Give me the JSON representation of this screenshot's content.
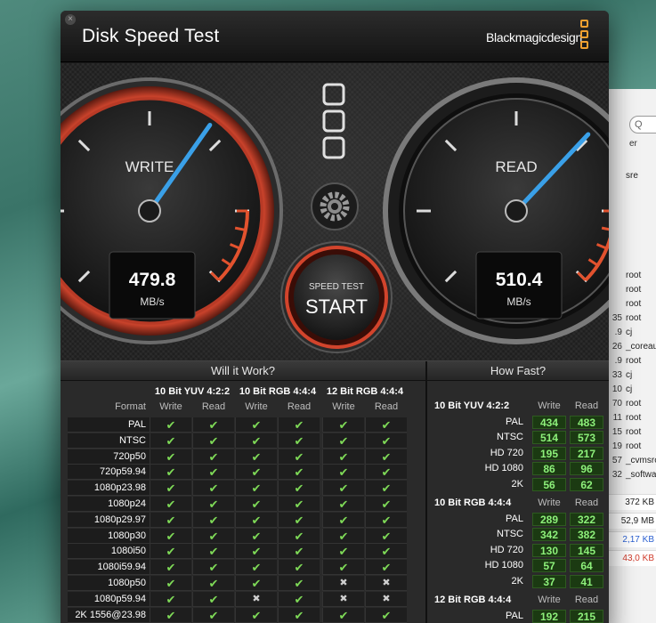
{
  "app": {
    "title": "Disk Speed Test",
    "brand": "Blackmagicdesign",
    "colors": {
      "accent": "#f0a030",
      "needle": "#3aa0e8",
      "ok": "#7ed957",
      "start_ring": "#d2442c"
    }
  },
  "gauges": {
    "write": {
      "label": "WRITE",
      "value": "479.8",
      "unit": "MB/s",
      "fraction": 0.63
    },
    "read": {
      "label": "READ",
      "value": "510.4",
      "unit": "MB/s",
      "fraction": 0.66
    }
  },
  "start_button": {
    "top": "SPEED TEST",
    "main": "START"
  },
  "icons": {
    "settings": "gear-icon",
    "close": "close-icon"
  },
  "will_it_work": {
    "title": "Will it Work?",
    "format_label": "Format",
    "groups": [
      "10 Bit YUV 4:2:2",
      "10 Bit RGB 4:4:4",
      "12 Bit RGB 4:4:4"
    ],
    "sub": [
      "Write",
      "Read",
      "Write",
      "Read",
      "Write",
      "Read"
    ],
    "rows": [
      {
        "format": "PAL",
        "cells": [
          1,
          1,
          1,
          1,
          1,
          1
        ]
      },
      {
        "format": "NTSC",
        "cells": [
          1,
          1,
          1,
          1,
          1,
          1
        ]
      },
      {
        "format": "720p50",
        "cells": [
          1,
          1,
          1,
          1,
          1,
          1
        ]
      },
      {
        "format": "720p59.94",
        "cells": [
          1,
          1,
          1,
          1,
          1,
          1
        ]
      },
      {
        "format": "1080p23.98",
        "cells": [
          1,
          1,
          1,
          1,
          1,
          1
        ]
      },
      {
        "format": "1080p24",
        "cells": [
          1,
          1,
          1,
          1,
          1,
          1
        ]
      },
      {
        "format": "1080p29.97",
        "cells": [
          1,
          1,
          1,
          1,
          1,
          1
        ]
      },
      {
        "format": "1080p30",
        "cells": [
          1,
          1,
          1,
          1,
          1,
          1
        ]
      },
      {
        "format": "1080i50",
        "cells": [
          1,
          1,
          1,
          1,
          1,
          1
        ]
      },
      {
        "format": "1080i59.94",
        "cells": [
          1,
          1,
          1,
          1,
          1,
          1
        ]
      },
      {
        "format": "1080p50",
        "cells": [
          1,
          1,
          1,
          1,
          0,
          0
        ]
      },
      {
        "format": "1080p59.94",
        "cells": [
          1,
          1,
          0,
          1,
          0,
          0
        ]
      },
      {
        "format": "2K 1556@23.98",
        "cells": [
          1,
          1,
          1,
          1,
          1,
          1
        ]
      }
    ]
  },
  "how_fast": {
    "title": "How Fast?",
    "write_label": "Write",
    "read_label": "Read",
    "groups": [
      {
        "name": "10 Bit YUV 4:2:2",
        "rows": [
          {
            "format": "PAL",
            "write": "434",
            "read": "483"
          },
          {
            "format": "NTSC",
            "write": "514",
            "read": "573"
          },
          {
            "format": "HD 720",
            "write": "195",
            "read": "217"
          },
          {
            "format": "HD 1080",
            "write": "86",
            "read": "96"
          },
          {
            "format": "2K",
            "write": "56",
            "read": "62"
          }
        ]
      },
      {
        "name": "10 Bit RGB 4:4:4",
        "rows": [
          {
            "format": "PAL",
            "write": "289",
            "read": "322"
          },
          {
            "format": "NTSC",
            "write": "342",
            "read": "382"
          },
          {
            "format": "HD 720",
            "write": "130",
            "read": "145"
          },
          {
            "format": "HD 1080",
            "write": "57",
            "read": "64"
          },
          {
            "format": "2K",
            "write": "37",
            "read": "41"
          }
        ]
      },
      {
        "name": "12 Bit RGB 4:4:4",
        "rows": [
          {
            "format": "PAL",
            "write": "192",
            "read": "215"
          },
          {
            "format": "NTSC",
            "write": "228",
            "read": "254"
          }
        ]
      }
    ]
  },
  "background_window": {
    "search_placeholder": "Q",
    "header": "er",
    "rows": [
      {
        "pid": "",
        "user": "sre"
      },
      {
        "pid": "",
        "user": ""
      },
      {
        "pid": "",
        "user": ""
      },
      {
        "pid": "",
        "user": ""
      },
      {
        "pid": "",
        "user": ""
      },
      {
        "pid": "",
        "user": ""
      },
      {
        "pid": "",
        "user": ""
      },
      {
        "pid": "",
        "user": "root"
      },
      {
        "pid": "",
        "user": "root"
      },
      {
        "pid": "",
        "user": "root"
      },
      {
        "pid": "35",
        "user": "root"
      },
      {
        "pid": ".9",
        "user": "cj"
      },
      {
        "pid": "26",
        "user": "_coreau"
      },
      {
        "pid": ".9",
        "user": "root"
      },
      {
        "pid": "33",
        "user": "cj"
      },
      {
        "pid": "10",
        "user": "cj"
      },
      {
        "pid": "70",
        "user": "root"
      },
      {
        "pid": "11",
        "user": "root"
      },
      {
        "pid": "15",
        "user": "root"
      },
      {
        "pid": "19",
        "user": "root"
      },
      {
        "pid": "57",
        "user": "_cvmsro"
      },
      {
        "pid": "32",
        "user": "_softwa"
      }
    ],
    "mem": [
      {
        "text": "372 KB",
        "color": "#222222"
      },
      {
        "text": "52,9 MB",
        "color": "#222222"
      },
      {
        "text": "2,17 KB",
        "color": "#2a5fd0"
      },
      {
        "text": "43,0 KB",
        "color": "#d03a2a"
      }
    ]
  }
}
